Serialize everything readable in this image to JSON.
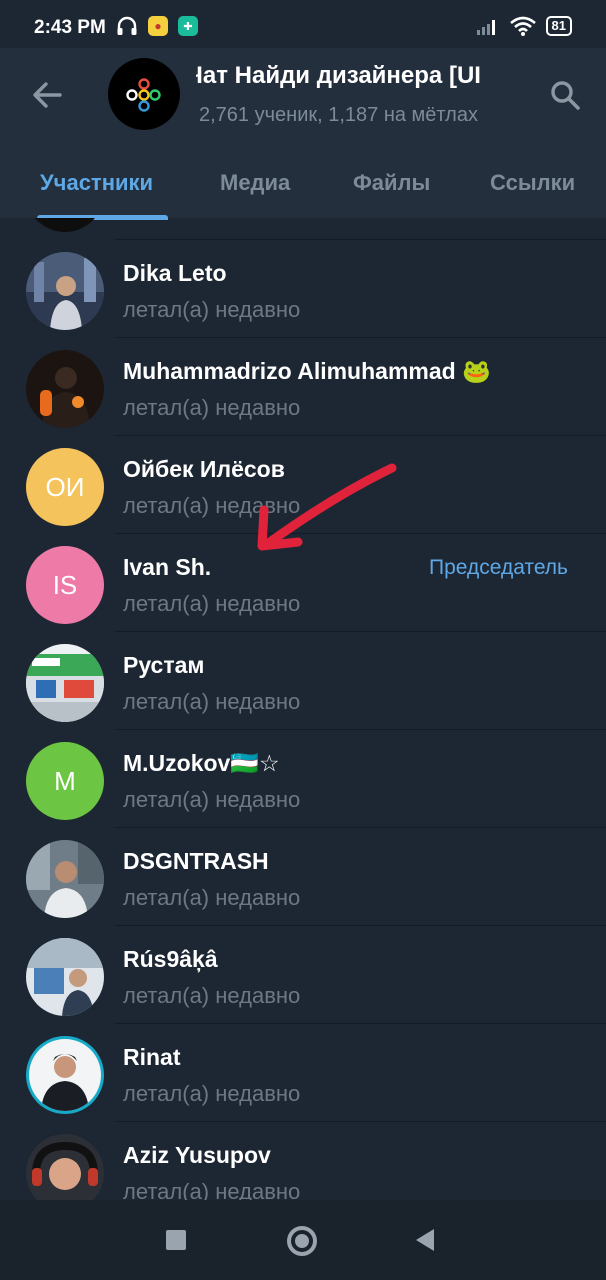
{
  "statusbar": {
    "time": "2:43 PM",
    "battery": "81",
    "icons": [
      "headphones-icon",
      "app-notification-icon",
      "app-notification-icon",
      "signal-icon",
      "wifi-icon",
      "battery-icon"
    ]
  },
  "header": {
    "title": "Чат Найди дизайнера [UI",
    "subtitle": "2,761 ученик, 1,187 на мётлах",
    "tabs": [
      {
        "label": "Участники",
        "active": true
      },
      {
        "label": "Медиа",
        "active": false
      },
      {
        "label": "Файлы",
        "active": false
      },
      {
        "label": "Ссылки",
        "active": false
      }
    ]
  },
  "members": [
    {
      "name": "Dika Leto",
      "status": "летал(а) недавно",
      "avatar_type": "photo"
    },
    {
      "name": "Muhammadrizo Alimuhammad 🐸",
      "status": "летал(а) недавно",
      "avatar_type": "photo"
    },
    {
      "name": "Ойбек Илёсов",
      "status": "летал(а) недавно",
      "avatar_initials": "ОИ",
      "avatar_color": "#f5c35b"
    },
    {
      "name": "Ivan Sh.",
      "status": "летал(а) недавно",
      "avatar_initials": "IS",
      "avatar_color": "#ee7aa7",
      "role": "Председатель"
    },
    {
      "name": "Рустам",
      "status": "летал(а) недавно",
      "avatar_type": "photo"
    },
    {
      "name": "M.Uzokov🇺🇿☆",
      "status": "летал(а) недавно",
      "avatar_initials": "M",
      "avatar_color": "#6cc644"
    },
    {
      "name": "DSGNTRASH",
      "status": "летал(а) недавно",
      "avatar_type": "photo"
    },
    {
      "name": "Rús9âķâ",
      "status": "летал(а) недавно",
      "avatar_type": "photo"
    },
    {
      "name": "Rinat",
      "status": "летал(а) недавно",
      "avatar_type": "photo"
    },
    {
      "name": "Aziz Yusupov",
      "status": "летал(а) недавно",
      "avatar_type": "photo"
    }
  ],
  "colors": {
    "accent": "#5ea8e6",
    "background": "#1d2733",
    "header": "#242f3d",
    "muted": "#6c7883",
    "annotation_arrow": "#e0233a"
  }
}
